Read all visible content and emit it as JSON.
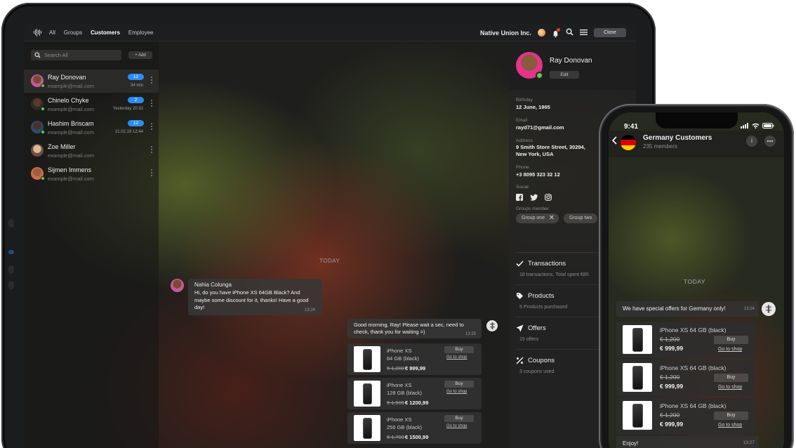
{
  "tablet": {
    "topbar": {
      "tabs": [
        {
          "label": "All",
          "active": false
        },
        {
          "label": "Groups",
          "active": false
        },
        {
          "label": "Customers",
          "active": true
        },
        {
          "label": "Employee",
          "active": false
        }
      ],
      "org_name": "Native Union Inc.",
      "close_label": "Close"
    },
    "sidebar": {
      "search_placeholder": "Search All",
      "add_label": "+ Add",
      "contacts": [
        {
          "name": "Ray Donovan",
          "email": "example@mail.com",
          "badge": "12",
          "time": "34 min",
          "online": true,
          "avatar_color": "#c45a9a"
        },
        {
          "name": "Chinelo Chyke",
          "email": "example@mail.com",
          "badge": "2",
          "time": "Yesterday 20:32",
          "online": true,
          "avatar_color": "#4a3a2e"
        },
        {
          "name": "Hashim Briscam",
          "email": "example@mail.com",
          "badge": "12",
          "time": "21.02.19 12:44",
          "online": true,
          "avatar_color": "#2e4a6a"
        },
        {
          "name": "Zoe Miller",
          "email": "example@mail.com",
          "badge": "",
          "time": "",
          "online": false,
          "avatar_color": "#c8a080"
        },
        {
          "name": "Sijmen Immens",
          "email": "example@mail.com",
          "badge": "",
          "time": "",
          "online": true,
          "avatar_color": "#d06a4a"
        }
      ]
    },
    "chat": {
      "today_label": "TODAY",
      "incoming": {
        "name": "Nahia Colunga",
        "text": "Hi, do you have iPhone XS 64GB Black? And maybe some discount for it, thanks! Have a good day!",
        "time": "13:24"
      },
      "outgoing": {
        "text": "Good morning, Ray! Please wait a sec, need to check, thank you for waiting =)",
        "time": "13:25"
      },
      "products": [
        {
          "name": "iPhone XS",
          "variant": "64 GB (black)",
          "old_price": "€ 1,200",
          "new_price": "€ 999,99",
          "buy": "Buy",
          "shop": "Go to shop"
        },
        {
          "name": "iPhone XS",
          "variant": "128 GB (black)",
          "old_price": "€ 1,500",
          "new_price": "€ 1200,99",
          "buy": "Buy",
          "shop": "Go to shop"
        },
        {
          "name": "iPhone XS",
          "variant": "256 GB (black)",
          "old_price": "€ 1,700",
          "new_price": "€ 1500,99",
          "buy": "Buy",
          "shop": "Go to shop"
        }
      ]
    },
    "profile": {
      "name": "Ray Donovan",
      "edit_label": "Edit",
      "birthday_label": "Birthday",
      "birthday": "12 June, 1965",
      "email_label": "Email",
      "email": "rayd71@gmail.com",
      "address_label": "Address",
      "address_line1": "9 Smith Store Street,  30294,",
      "address_line2": "New York, USA",
      "phone_label": "Phone",
      "phone": "+3 8095 323 32 12",
      "social_label": "Social",
      "groups_label": "Groups member",
      "groups": [
        "Group one",
        "Group two"
      ],
      "sections": [
        {
          "title": "Transactions",
          "sub": "18 transactions, Total spent €85",
          "icon": "check-icon"
        },
        {
          "title": "Products",
          "sub": "5 Products purchased",
          "icon": "tag-icon"
        },
        {
          "title": "Offers",
          "sub": "15 offers",
          "icon": "send-icon"
        },
        {
          "title": "Coupons",
          "sub": "3 coupons used",
          "icon": "percent-icon"
        }
      ]
    }
  },
  "phone": {
    "status_time": "9:41",
    "group_title": "Germany Customers",
    "members": "235 members",
    "info_label": "i",
    "today_label": "TODAY",
    "offer_text": "We have special offers for Germany only!",
    "offer_time": "13:24",
    "products": [
      {
        "name": "iPhone XS 64 GB (black)",
        "old_price": "€ 1,200",
        "new_price": "€ 999,99",
        "buy": "Buy",
        "shop": "Go to shop"
      },
      {
        "name": "iPhone XS 64 GB (black)",
        "old_price": "€ 1,200",
        "new_price": "€ 999,99",
        "buy": "Buy",
        "shop": "Go to shop"
      },
      {
        "name": "iPhone XS 64 GB (black)",
        "old_price": "€ 1,200",
        "new_price": "€ 999,99",
        "buy": "Buy",
        "shop": "Go to shop"
      }
    ],
    "enjoy_text": "Enjoy!",
    "enjoy_time": "13:27"
  }
}
